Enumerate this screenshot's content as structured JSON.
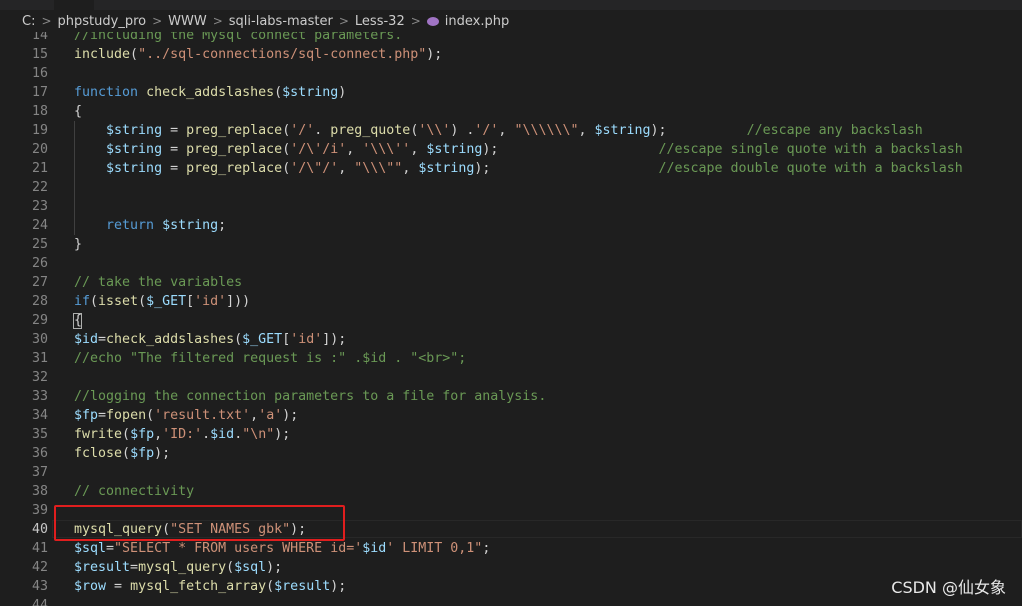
{
  "breadcrumb": {
    "items": [
      "C:",
      "phpstudy_pro",
      "WWW",
      "sqli-labs-master",
      "Less-32"
    ],
    "file": "index.php",
    "file_icon": "php-icon"
  },
  "lines": [
    {
      "n": "14",
      "tokens": [
        [
          "cm",
          "//including the Mysql connect parameters."
        ]
      ]
    },
    {
      "n": "15",
      "tokens": [
        [
          "fn",
          "include"
        ],
        [
          "p",
          "("
        ],
        [
          "str",
          "\"../sql-connections/sql-connect.php\""
        ],
        [
          "p",
          ");"
        ]
      ]
    },
    {
      "n": "16",
      "tokens": []
    },
    {
      "n": "17",
      "tokens": [
        [
          "kw",
          "function"
        ],
        [
          "p",
          " "
        ],
        [
          "fn",
          "check_addslashes"
        ],
        [
          "p",
          "("
        ],
        [
          "var",
          "$string"
        ],
        [
          "p",
          ")"
        ]
      ]
    },
    {
      "n": "18",
      "tokens": [
        [
          "p",
          "{"
        ]
      ]
    },
    {
      "n": "19",
      "tokens": [
        [
          "p",
          "    "
        ],
        [
          "var",
          "$string"
        ],
        [
          "p",
          " = "
        ],
        [
          "fn",
          "preg_replace"
        ],
        [
          "p",
          "("
        ],
        [
          "str",
          "'/'"
        ],
        [
          "p",
          ". "
        ],
        [
          "fn",
          "preg_quote"
        ],
        [
          "p",
          "("
        ],
        [
          "str",
          "'\\\\'"
        ],
        [
          "p",
          ") ."
        ],
        [
          "str",
          "'/'"
        ],
        [
          "p",
          ", "
        ],
        [
          "str",
          "\"\\\\\\\\\\\\\""
        ],
        [
          "p",
          ", "
        ],
        [
          "var",
          "$string"
        ],
        [
          "p",
          ");          "
        ],
        [
          "cm",
          "//escape any backslash"
        ]
      ]
    },
    {
      "n": "20",
      "tokens": [
        [
          "p",
          "    "
        ],
        [
          "var",
          "$string"
        ],
        [
          "p",
          " = "
        ],
        [
          "fn",
          "preg_replace"
        ],
        [
          "p",
          "("
        ],
        [
          "str",
          "'/\\'/i'"
        ],
        [
          "p",
          ", "
        ],
        [
          "str",
          "'\\\\\\''"
        ],
        [
          "p",
          ", "
        ],
        [
          "var",
          "$string"
        ],
        [
          "p",
          ");                    "
        ],
        [
          "cm",
          "//escape single quote with a backslash"
        ]
      ]
    },
    {
      "n": "21",
      "tokens": [
        [
          "p",
          "    "
        ],
        [
          "var",
          "$string"
        ],
        [
          "p",
          " = "
        ],
        [
          "fn",
          "preg_replace"
        ],
        [
          "p",
          "("
        ],
        [
          "str",
          "'/\\\"/'"
        ],
        [
          "p",
          ", "
        ],
        [
          "str",
          "\"\\\\\\\"\""
        ],
        [
          "p",
          ", "
        ],
        [
          "var",
          "$string"
        ],
        [
          "p",
          ");                     "
        ],
        [
          "cm",
          "//escape double quote with a backslash"
        ]
      ]
    },
    {
      "n": "22",
      "tokens": []
    },
    {
      "n": "23",
      "tokens": []
    },
    {
      "n": "24",
      "tokens": [
        [
          "p",
          "    "
        ],
        [
          "kw",
          "return"
        ],
        [
          "p",
          " "
        ],
        [
          "var",
          "$string"
        ],
        [
          "p",
          ";"
        ]
      ]
    },
    {
      "n": "25",
      "tokens": [
        [
          "p",
          "}"
        ]
      ]
    },
    {
      "n": "26",
      "tokens": []
    },
    {
      "n": "27",
      "tokens": [
        [
          "cm",
          "// take the variables"
        ]
      ]
    },
    {
      "n": "28",
      "tokens": [
        [
          "kw",
          "if"
        ],
        [
          "p",
          "("
        ],
        [
          "fn",
          "isset"
        ],
        [
          "p",
          "("
        ],
        [
          "var",
          "$_GET"
        ],
        [
          "p",
          "["
        ],
        [
          "str",
          "'id'"
        ],
        [
          "p",
          "]))"
        ]
      ]
    },
    {
      "n": "29",
      "tokens": [
        [
          "p",
          "{"
        ]
      ]
    },
    {
      "n": "30",
      "tokens": [
        [
          "var",
          "$id"
        ],
        [
          "p",
          "="
        ],
        [
          "fn",
          "check_addslashes"
        ],
        [
          "p",
          "("
        ],
        [
          "var",
          "$_GET"
        ],
        [
          "p",
          "["
        ],
        [
          "str",
          "'id'"
        ],
        [
          "p",
          "]);"
        ]
      ]
    },
    {
      "n": "31",
      "tokens": [
        [
          "cm",
          "//echo \"The filtered request is :\" .$id . \"<br>\";"
        ]
      ]
    },
    {
      "n": "32",
      "tokens": []
    },
    {
      "n": "33",
      "tokens": [
        [
          "cm",
          "//logging the connection parameters to a file for analysis."
        ]
      ]
    },
    {
      "n": "34",
      "tokens": [
        [
          "var",
          "$fp"
        ],
        [
          "p",
          "="
        ],
        [
          "fn",
          "fopen"
        ],
        [
          "p",
          "("
        ],
        [
          "str",
          "'result.txt'"
        ],
        [
          "p",
          ","
        ],
        [
          "str",
          "'a'"
        ],
        [
          "p",
          ");"
        ]
      ]
    },
    {
      "n": "35",
      "tokens": [
        [
          "fn",
          "fwrite"
        ],
        [
          "p",
          "("
        ],
        [
          "var",
          "$fp"
        ],
        [
          "p",
          ","
        ],
        [
          "str",
          "'ID:'"
        ],
        [
          "p",
          "."
        ],
        [
          "var",
          "$id"
        ],
        [
          "p",
          "."
        ],
        [
          "str",
          "\"\\n\""
        ],
        [
          "p",
          ");"
        ]
      ]
    },
    {
      "n": "36",
      "tokens": [
        [
          "fn",
          "fclose"
        ],
        [
          "p",
          "("
        ],
        [
          "var",
          "$fp"
        ],
        [
          "p",
          ");"
        ]
      ]
    },
    {
      "n": "37",
      "tokens": []
    },
    {
      "n": "38",
      "tokens": [
        [
          "cm",
          "// connectivity"
        ]
      ]
    },
    {
      "n": "39",
      "tokens": []
    },
    {
      "n": "40",
      "tokens": [
        [
          "fn",
          "mysql_query"
        ],
        [
          "p",
          "("
        ],
        [
          "str",
          "\"SET NAMES gbk\""
        ],
        [
          "p",
          ");"
        ]
      ]
    },
    {
      "n": "41",
      "tokens": [
        [
          "var",
          "$sql"
        ],
        [
          "p",
          "="
        ],
        [
          "str",
          "\"SELECT * FROM users WHERE id='"
        ],
        [
          "var",
          "$id"
        ],
        [
          "str",
          "' LIMIT 0,1\""
        ],
        [
          "p",
          ";"
        ]
      ]
    },
    {
      "n": "42",
      "tokens": [
        [
          "var",
          "$result"
        ],
        [
          "p",
          "="
        ],
        [
          "fn",
          "mysql_query"
        ],
        [
          "p",
          "("
        ],
        [
          "var",
          "$sql"
        ],
        [
          "p",
          ");"
        ]
      ]
    },
    {
      "n": "43",
      "tokens": [
        [
          "var",
          "$row"
        ],
        [
          "p",
          " = "
        ],
        [
          "fn",
          "mysql_fetch_array"
        ],
        [
          "p",
          "("
        ],
        [
          "var",
          "$result"
        ],
        [
          "p",
          ");"
        ]
      ]
    },
    {
      "n": "44",
      "tokens": []
    }
  ],
  "active_line": "40",
  "highlighted_line": "40",
  "watermark": "CSDN @仙女象",
  "colors": {
    "background": "#1e1e1e",
    "keyword": "#569cd6",
    "function": "#dcdcaa",
    "variable": "#9cdcfe",
    "string": "#ce9178",
    "comment": "#6a9955",
    "highlight_box": "#e01e1e"
  }
}
